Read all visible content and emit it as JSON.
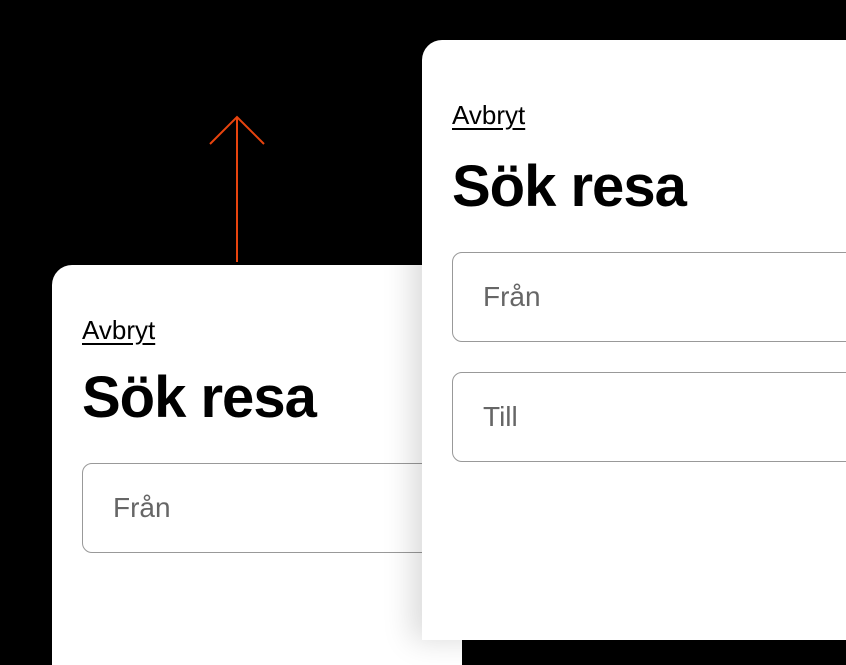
{
  "colors": {
    "arrow": "#E8440E"
  },
  "sheetBack": {
    "cancel": "Avbryt",
    "title": "Sök resa",
    "from": {
      "placeholder": "Från"
    }
  },
  "sheetFront": {
    "cancel": "Avbryt",
    "title": "Sök resa",
    "from": {
      "placeholder": "Från"
    },
    "to": {
      "placeholder": "Till"
    }
  }
}
